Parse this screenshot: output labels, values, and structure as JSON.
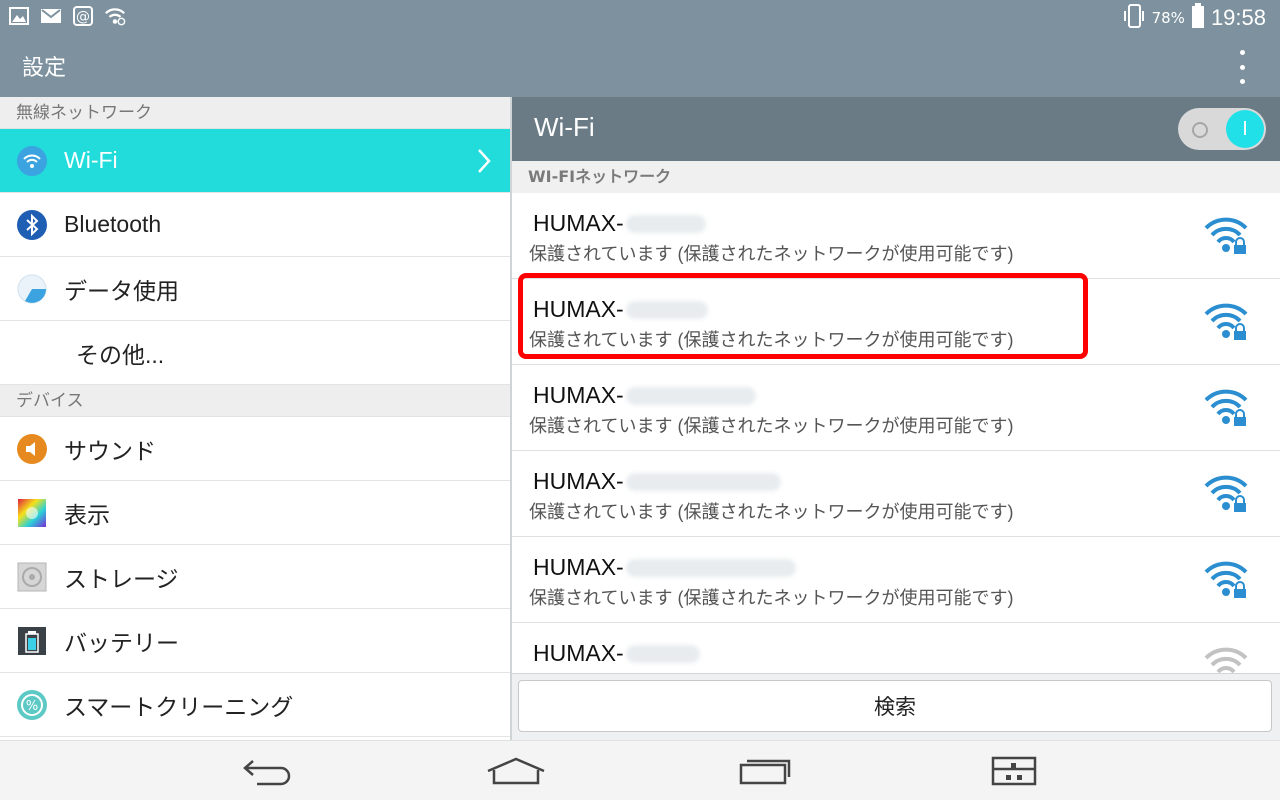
{
  "status_bar": {
    "icons": [
      "picture-icon",
      "gmail-icon",
      "at-email-icon",
      "wifi-notification-icon"
    ],
    "battery_percent": "78%",
    "time": "19:58",
    "right_icons": [
      "vibrate-icon",
      "battery-icon"
    ]
  },
  "action_bar": {
    "title": "設定",
    "overflow_icon": "overflow-menu-icon"
  },
  "left_pane": {
    "sections": [
      {
        "header": "無線ネットワーク",
        "items": [
          {
            "label": "Wi-Fi",
            "icon": "wifi-icon",
            "selected": true
          },
          {
            "label": "Bluetooth",
            "icon": "bluetooth-icon"
          },
          {
            "label": "データ使用",
            "icon": "data-usage-icon"
          },
          {
            "label": "その他...",
            "icon": ""
          }
        ]
      },
      {
        "header": "デバイス",
        "items": [
          {
            "label": "サウンド",
            "icon": "sound-icon"
          },
          {
            "label": "表示",
            "icon": "display-icon"
          },
          {
            "label": "ストレージ",
            "icon": "storage-icon"
          },
          {
            "label": "バッテリー",
            "icon": "battery-settings-icon"
          },
          {
            "label": "スマートクリーニング",
            "icon": "smart-cleaning-icon"
          }
        ]
      }
    ]
  },
  "right_pane": {
    "title": "Wi-Fi",
    "toggle": {
      "state": "on",
      "on_glyph": "I"
    },
    "section_header": "WI-FIネットワーク",
    "networks": [
      {
        "ssid": "HUMAX-",
        "status": "保護されています (保護されたネットワークが使用可能です)",
        "signal": "strong-locked"
      },
      {
        "ssid": "HUMAX-",
        "status": "保護されています (保護されたネットワークが使用可能です)",
        "signal": "strong-locked"
      },
      {
        "ssid": "HUMAX-",
        "status": "保護されています (保護されたネットワークが使用可能です)",
        "signal": "strong-locked"
      },
      {
        "ssid": "HUMAX-",
        "status": "保護されています (保護されたネットワークが使用可能です)",
        "signal": "strong-locked"
      },
      {
        "ssid": "HUMAX-",
        "status": "保護されています (保護されたネットワークが使用可能です)",
        "signal": "strong-locked"
      },
      {
        "ssid": "HUMAX-",
        "status": "",
        "signal": "weak"
      }
    ],
    "scan_button": "検索"
  },
  "nav_bar": {
    "buttons": [
      "back-icon",
      "home-icon",
      "recent-apps-icon",
      "dual-window-icon"
    ]
  },
  "colors": {
    "status_bar": "#7d929e",
    "selected_item": "#22dcdc",
    "wifi_header": "#6a7b85",
    "toggle_knob": "#22e0e8",
    "highlight": "#ff0000",
    "signal_blue": "#2a8ed0"
  }
}
